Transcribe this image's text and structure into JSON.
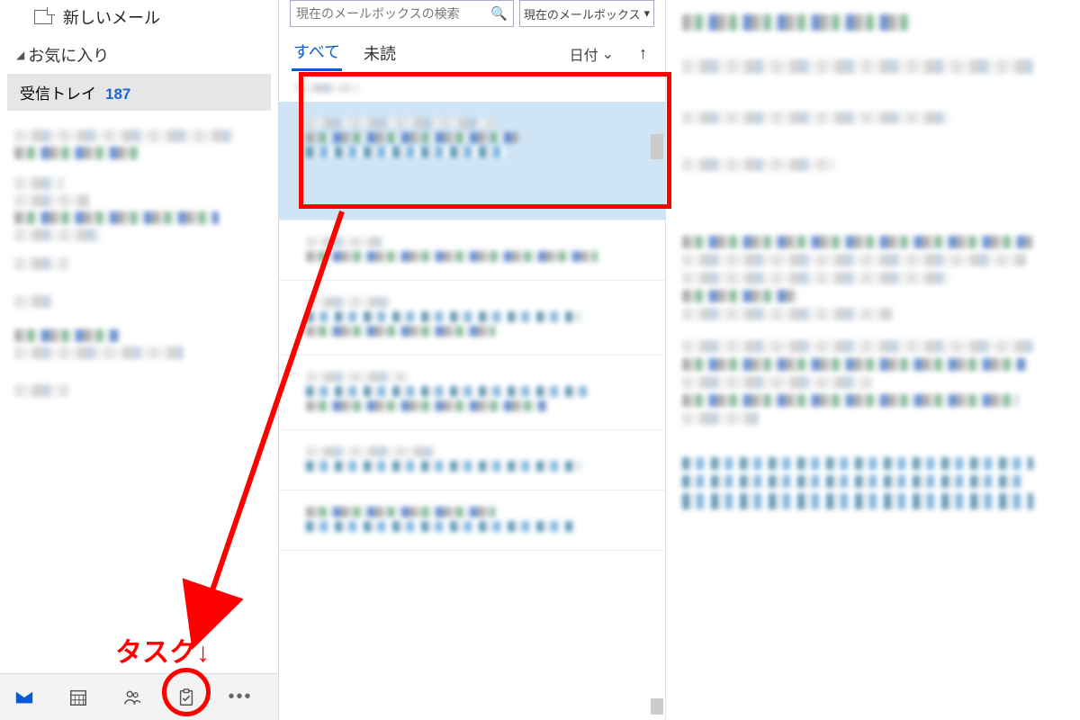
{
  "sidebar": {
    "new_mail_label": "新しいメール",
    "favorites_header": "お気に入り",
    "inbox_label": "受信トレイ",
    "inbox_count": "187"
  },
  "bottom_nav": {
    "mail": "mail-icon",
    "calendar": "calendar-icon",
    "people": "people-icon",
    "tasks": "tasks-icon",
    "overflow": "…"
  },
  "list": {
    "search_placeholder": "現在のメールボックスの検索",
    "scope_label": "現在のメールボックス",
    "tab_all": "すべて",
    "tab_unread": "未読",
    "sort_label": "日付",
    "sort_dir_icon": "↑"
  },
  "annotation": {
    "task_label": "タスク↓"
  }
}
